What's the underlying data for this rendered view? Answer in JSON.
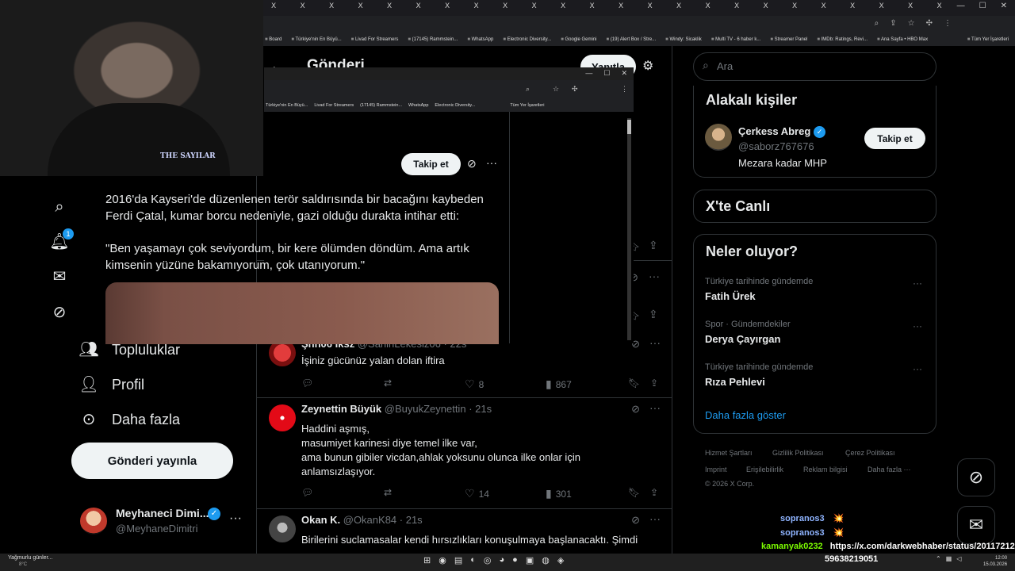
{
  "browser": {
    "tab_glyph": "X",
    "bookmarks": [
      "Board",
      "Türkiye'nin En Büyü...",
      "Livad For Streamers",
      "(17145) Rammstein...",
      "WhatsApp",
      "Electronic Diversity...",
      "Google Gemini",
      "(19) Alert Box / Stre...",
      "Windy: Sicaklik",
      "Multi TV - 6 haber k...",
      "Streamer Panel",
      "IMDb: Ratings, Revi...",
      "Ana Sayfa • HBO Max"
    ],
    "bookmarks_right": "Tüm Yer İşaretleri"
  },
  "popup": {
    "bookmarks": [
      "Türkiye'nin En Büyü...",
      "Livad For Streamers",
      "(17145) Rammstein...",
      "WhatsApp",
      "Electronic Diversity..."
    ],
    "bookmarks_right": "Tüm Yer İşaretleri"
  },
  "cam": {
    "logo_text": "THE SAYILAR"
  },
  "nav": {
    "notifications_badge": "1",
    "communities": "Topluluklar",
    "profile": "Profil",
    "more": "Daha fazla",
    "post_button": "Gönderi yayınla"
  },
  "account": {
    "name": "Meyhaneci Dimi...",
    "handle": "@MeyhaneDimitri"
  },
  "header": {
    "title": "Gönderi",
    "reply_button": "Yanıtla"
  },
  "post": {
    "follow_button": "Takip et",
    "text1": "2016'da Kayseri'de düzenlenen terör saldırısında bir bacağını kaybeden Ferdi Çatal, kumar borcu nedeniyle, gazi olduğu durakta intihar etti:",
    "text2": "\"Ben yaşamayı çok seviyordum, bir kere ölümden döndüm. Ama artık kimsenin yüzüne bakamıyorum, çok utanıyorum.\""
  },
  "replies": [
    {
      "name": "Şhh06 İksz",
      "handle": "@SahinLekesiz06",
      "time": "· 22s",
      "text": "İşiniz gücünüz yalan dolan iftira",
      "likes": "8",
      "views": "867"
    },
    {
      "name": "Zeynettin Büyük",
      "handle": "@BuyukZeynettin",
      "time": "· 21s",
      "lines": [
        "Haddini aşmış,",
        "masumiyet karinesi diye temel ilke var,",
        "ama bunun gibiler vicdan,ahlak yoksunu olunca ilke onlar için",
        "anlamsızlaşıyor."
      ],
      "likes": "14",
      "views": "301"
    },
    {
      "name": "Okan K.",
      "handle": "@OkanK84",
      "time": "· 21s",
      "lines": [
        "Birilerini suclamasalar kendi hırsızlıkları konuşulmaya başlanacaktı. Şimdi"
      ]
    }
  ],
  "sidebar": {
    "search_placeholder": "Ara",
    "related_title": "Alakalı kişiler",
    "related_user": {
      "name": "Çerkess Abreg",
      "handle": "@saborz767676",
      "bio": "Mezara kadar MHP",
      "follow_button": "Takip et"
    },
    "live_title": "X'te Canlı",
    "trends_title": "Neler oluyor?",
    "trends": [
      {
        "context": "Türkiye tarihinde gündemde",
        "name": "Fatih Ürek"
      },
      {
        "context": "Spor · Gündemdekiler",
        "name": "Derya Çayırgan"
      },
      {
        "context": "Türkiye tarihinde gündemde",
        "name": "Rıza Pehlevi"
      }
    ],
    "show_more": "Daha fazla göster",
    "footer": {
      "terms": "Hizmet Şartları",
      "privacy": "Gizlilik Politikası",
      "cookies": "Çerez Politikası",
      "imprint": "Imprint",
      "accessibility": "Erişilebilirlik",
      "ads": "Reklam bilgisi",
      "more": "Daha fazla ···",
      "copyright": "© 2026 X Corp."
    }
  },
  "taskbar": {
    "weather_title": "Yağmurlu günler...",
    "weather_temp": "8°C",
    "time": "12:00",
    "date": "15.03.2026"
  },
  "chat": {
    "messages": [
      {
        "user": "sopranos3",
        "text": "💥",
        "color": "#8fb4ff"
      },
      {
        "user": "sopranos3",
        "text": "💥",
        "color": "#8fb4ff"
      },
      {
        "user": "kamanyak0232",
        "text": "https://x.com/darkwebhaber/status/20117212",
        "color": "#7cfc00"
      }
    ],
    "total": "59638219051"
  },
  "colors": {
    "accent": "#1d9bf0",
    "background": "#000000",
    "border": "#2f3336",
    "muted": "#71767b"
  }
}
